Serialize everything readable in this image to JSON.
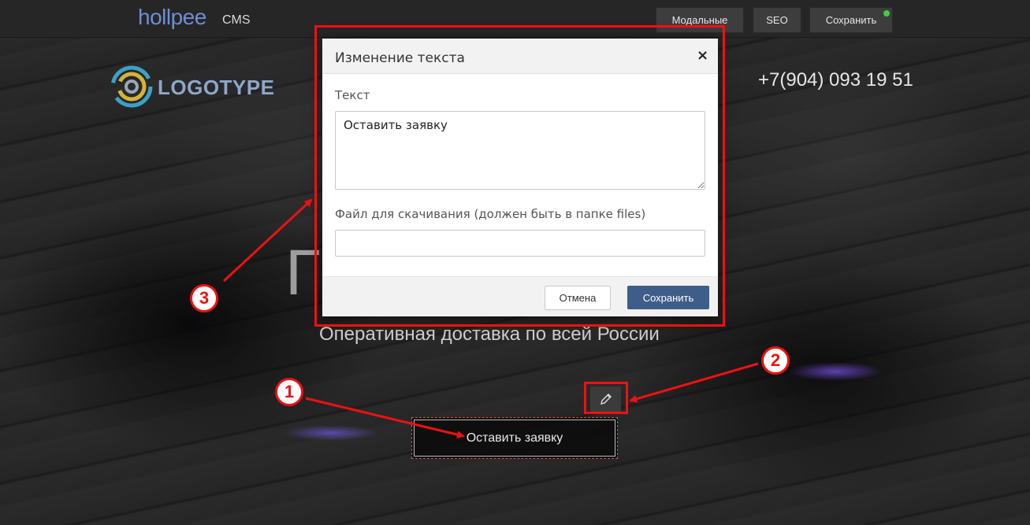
{
  "cms": {
    "brand": "hollpee",
    "brand_suffix": "CMS",
    "buttons": {
      "modals": "Модальные",
      "seo": "SEO",
      "save": "Сохранить"
    },
    "save_status_color": "#3fcf3f"
  },
  "site": {
    "logo_text": "LOGOTYPE",
    "phone": "+7(904) 093 19 51",
    "heading_visible": "Г                     Ы",
    "subtitle": "Оперативная доставка по всей России",
    "order_button": "Оставить заявку",
    "edit_icon": "pencil-icon"
  },
  "modal": {
    "title": "Изменение текста",
    "close_glyph": "×",
    "text_label": "Текст",
    "text_value": "Оставить заявку",
    "file_label": "Файл для скачивания (должен быть в папке files)",
    "file_value": "",
    "cancel": "Отмена",
    "save": "Сохранить"
  },
  "annotations": {
    "color": "#ee1111",
    "markers": [
      "1",
      "2",
      "3"
    ]
  }
}
